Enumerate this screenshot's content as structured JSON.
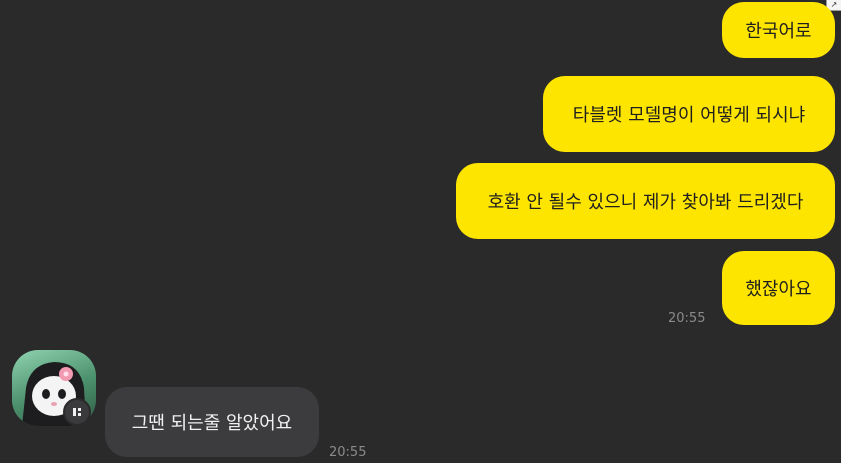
{
  "messages": [
    {
      "text": "한국어로"
    },
    {
      "text": "타블렛 모델명이 어떻게 되시냐"
    },
    {
      "text": "호환 안 될수 있으니 제가 찾아봐 드리겠다"
    },
    {
      "text": "했잖아요"
    }
  ],
  "my_time": "20:55",
  "reply": {
    "text": "그땐 되는줄 알았어요",
    "time": "20:55"
  },
  "icons": {
    "avatar": "kuromi-profile-avatar",
    "badge": "profile-badge-icon",
    "corner": "expand-arrow-icon"
  },
  "colors": {
    "background": "#2a2a2b",
    "my_bubble": "#fee500",
    "other_bubble": "#3c3c3e"
  }
}
